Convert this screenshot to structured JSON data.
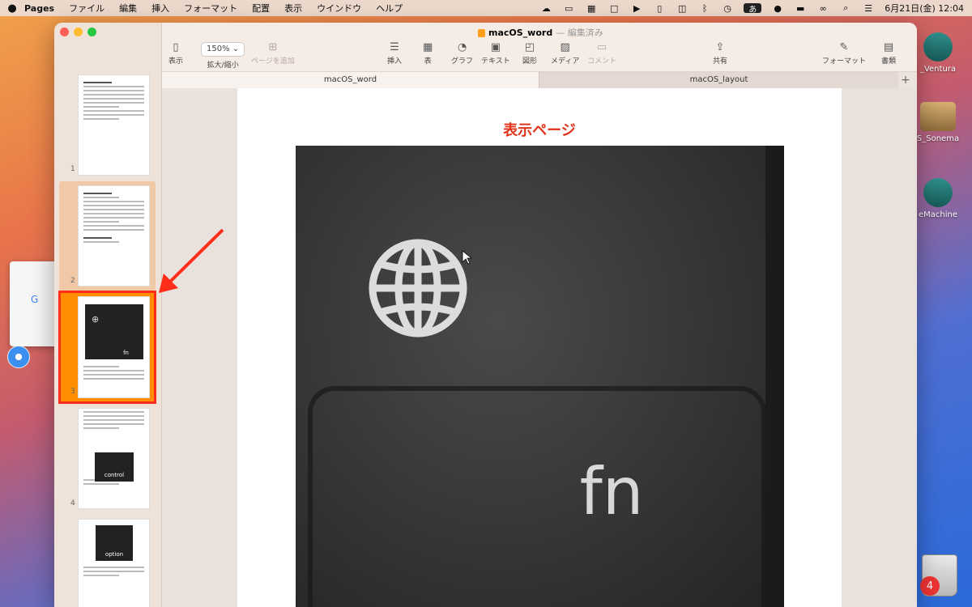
{
  "menubar": {
    "app_name": "Pages",
    "items": [
      "ファイル",
      "編集",
      "挿入",
      "フォーマット",
      "配置",
      "表示",
      "ウインドウ",
      "ヘルプ"
    ],
    "ime": "あ",
    "date_time": "6月21日(金)  12:04"
  },
  "desktop": {
    "disks": [
      "_Ventura",
      "S_Sonema",
      "eMachine"
    ],
    "trash_badge": "4"
  },
  "window": {
    "doc_name": "macOS_word",
    "doc_status": "— 編集済み",
    "toolbar": {
      "view": "表示",
      "zoom_value": "150%",
      "zoom_label": "拡大/縮小",
      "add_page": "ページを追加",
      "insert": "挿入",
      "table": "表",
      "chart": "グラフ",
      "text": "テキスト",
      "shape": "図形",
      "media": "メディア",
      "comment": "コメント",
      "share": "共有",
      "format": "フォーマット",
      "document": "書類"
    },
    "tabs": [
      "macOS_word",
      "macOS_layout"
    ],
    "thumbnails": [
      {
        "num": "1"
      },
      {
        "num": "2"
      },
      {
        "num": "3",
        "key_label": "fn"
      },
      {
        "num": "4",
        "key_label": "control"
      },
      {
        "num": "5",
        "key_label": "option"
      }
    ],
    "page": {
      "title": "表示ページ",
      "key_label": "fn"
    }
  }
}
